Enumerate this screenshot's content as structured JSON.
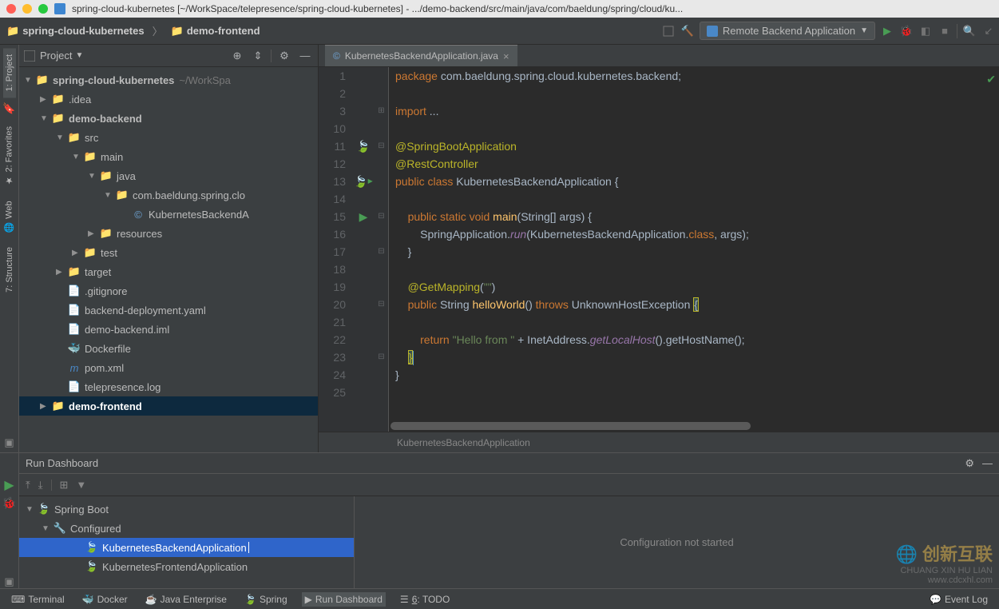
{
  "titlebar": "spring-cloud-kubernetes [~/WorkSpace/telepresence/spring-cloud-kubernetes] - .../demo-backend/src/main/java/com/baeldung/spring/cloud/ku...",
  "breadcrumb": {
    "item1": "spring-cloud-kubernetes",
    "item2": "demo-frontend"
  },
  "runConfig": {
    "label": "Remote Backend Application"
  },
  "projectPane": {
    "title": "Project",
    "root": {
      "label": "spring-cloud-kubernetes",
      "hint": "~/WorkSpa"
    },
    "nodes": {
      "idea": ".idea",
      "demoBackend": "demo-backend",
      "src": "src",
      "main": "main",
      "java": "java",
      "pkg": "com.baeldung.spring.clo",
      "appFile": "KubernetesBackendA",
      "resources": "resources",
      "test": "test",
      "target": "target",
      "gitignore": ".gitignore",
      "deployYaml": "backend-deployment.yaml",
      "iml": "demo-backend.iml",
      "dockerfile": "Dockerfile",
      "pom": "pom.xml",
      "telelog": "telepresence.log",
      "demoFrontend": "demo-frontend"
    }
  },
  "editorTab": {
    "label": "KubernetesBackendApplication.java"
  },
  "code": {
    "lines": [
      {
        "n": "1",
        "html": "<span class='k'>package</span> <span class='c'>com.baeldung.spring.cloud.kubernetes.backend;</span>"
      },
      {
        "n": "2",
        "html": ""
      },
      {
        "n": "3",
        "html": "<span class='k'>import</span> <span class='c'>...</span>",
        "fold": "⊞"
      },
      {
        "n": "10",
        "html": ""
      },
      {
        "n": "11",
        "html": "<span class='a'>@SpringBootApplication</span>",
        "mark": "run",
        "fold": "⊟"
      },
      {
        "n": "12",
        "html": "<span class='a'>@RestController</span>"
      },
      {
        "n": "13",
        "html": "<span class='k'>public class</span> <span class='c'>KubernetesBackendApplication {</span>",
        "mark": "runplay"
      },
      {
        "n": "14",
        "html": ""
      },
      {
        "n": "15",
        "html": "    <span class='k'>public static void</span> <span class='f'>main</span><span class='c'>(String[] args) {</span>",
        "mark": "play",
        "fold": "⊟"
      },
      {
        "n": "16",
        "html": "        <span class='c'>SpringApplication.</span><span class='i'>run</span><span class='c'>(KubernetesBackendApplication.</span><span class='k'>class</span><span class='c'>, args);</span>"
      },
      {
        "n": "17",
        "html": "    <span class='c'>}</span>",
        "fold": "⊟"
      },
      {
        "n": "18",
        "html": ""
      },
      {
        "n": "19",
        "html": "    <span class='a'>@GetMapping</span><span class='c'>(</span><span class='s'>\"\"</span><span class='c'>)</span>"
      },
      {
        "n": "20",
        "html": "    <span class='k'>public</span> <span class='c'>String </span><span class='f'>helloWorld</span><span class='c'>() </span><span class='k'>throws</span> <span class='c'>UnknownHostException </span><span class='hlbrace c'>{</span>",
        "fold": "⊟"
      },
      {
        "n": "21",
        "html": ""
      },
      {
        "n": "22",
        "html": "        <span class='k'>return</span> <span class='s'>\"Hello from \"</span> <span class='c'>+ InetAddress.</span><span class='i'>getLocalHost</span><span class='c'>().getHostName();</span>"
      },
      {
        "n": "23",
        "html": "    <span class='hlbrace a'>}</span><span class='caret'></span>",
        "fold": "⊟"
      },
      {
        "n": "24",
        "html": "<span class='c'>}</span>"
      },
      {
        "n": "25",
        "html": ""
      }
    ]
  },
  "editorBreadcrumb": "KubernetesBackendApplication",
  "leftRail": {
    "project": "1: Project",
    "favorites": "2: Favorites",
    "web": "Web",
    "structure": "7: Structure"
  },
  "dashboard": {
    "title": "Run Dashboard",
    "message": "Configuration not started",
    "tree": {
      "springBoot": "Spring Boot",
      "configured": "Configured",
      "app1": "KubernetesBackendApplication",
      "app2": "KubernetesFrontendApplication"
    }
  },
  "statusbar": {
    "terminal": "Terminal",
    "docker": "Docker",
    "javaee": "Java Enterprise",
    "spring": "Spring",
    "runDash": "Run Dashboard",
    "todo": "6: TODO",
    "eventLog": "Event Log"
  },
  "watermark": {
    "brand": "创新互联",
    "sub": "CHUANG XIN HU LIAN",
    "site": "www.cdcxhl.com"
  }
}
